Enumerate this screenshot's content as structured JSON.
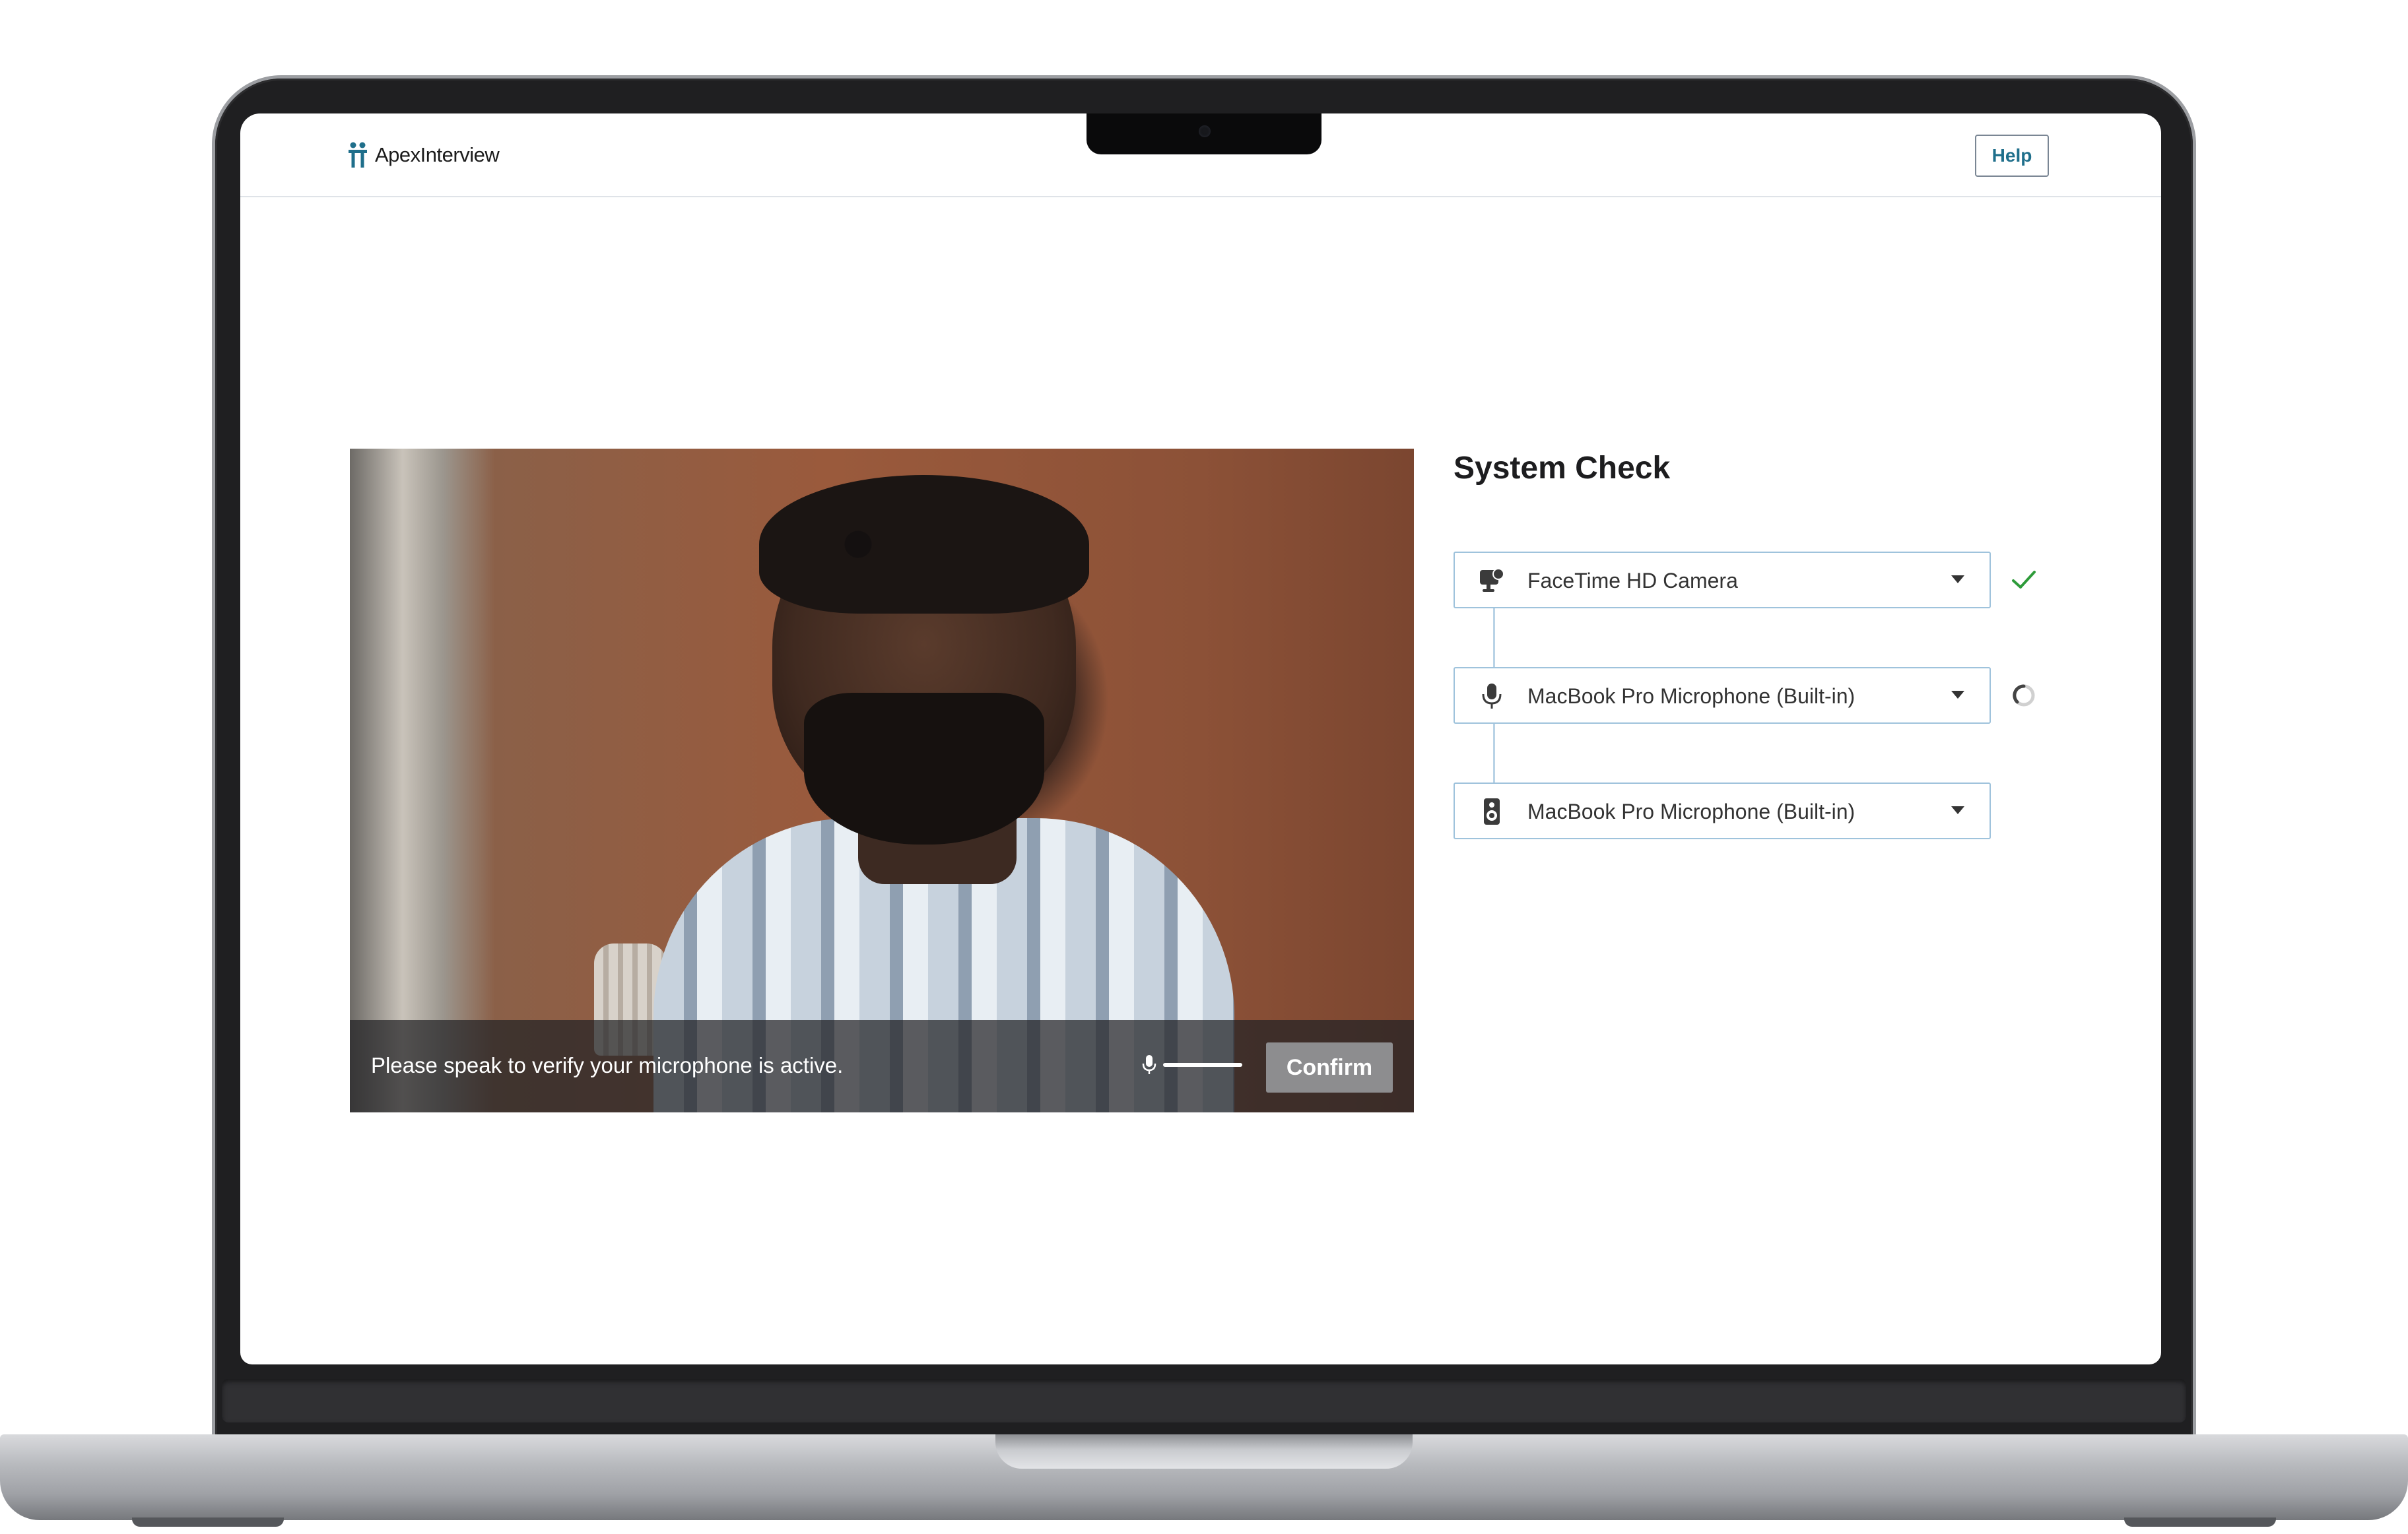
{
  "app": {
    "brand_name": "ApexInterview",
    "help_label": "Help"
  },
  "video": {
    "prompt_text": "Please speak to verify your microphone is active.",
    "confirm_label": "Confirm",
    "mic_level_icon": "mic-icon"
  },
  "system_check": {
    "title": "System Check",
    "devices": [
      {
        "icon": "webcam-icon",
        "label": "FaceTime HD Camera",
        "status": "checked",
        "status_color": "#2e9b3a"
      },
      {
        "icon": "mic-icon",
        "label": "MacBook Pro Microphone (Built-in)",
        "status": "loading"
      },
      {
        "icon": "speaker-icon",
        "label": "MacBook Pro Microphone (Built-in)",
        "status": "none"
      }
    ]
  },
  "colors": {
    "brand_accent": "#1f6f8b",
    "field_border": "#9fc3dc",
    "confirm_bg": "#8d8d8f"
  }
}
